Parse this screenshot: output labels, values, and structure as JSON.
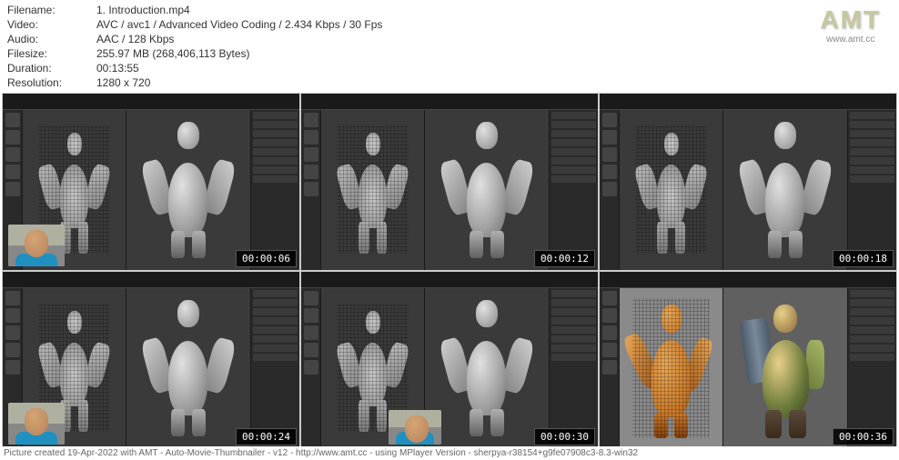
{
  "meta": {
    "filename_label": "Filename:",
    "filename": "1. Introduction.mp4",
    "video_label": "Video:",
    "video": "AVC / avc1 / Advanced Video Coding / 2.434 Kbps / 30 Fps",
    "audio_label": "Audio:",
    "audio": "AAC / 128 Kbps",
    "filesize_label": "Filesize:",
    "filesize": "255.97 MB (268,406,113 Bytes)",
    "duration_label": "Duration:",
    "duration": "00:13:55",
    "resolution_label": "Resolution:",
    "resolution": "1280 x 720"
  },
  "logo": {
    "text": "AMT",
    "url": "www.amt.cc"
  },
  "thumbs": {
    "t1": "00:00:06",
    "t2": "00:00:12",
    "t3": "00:00:18",
    "t4": "00:00:24",
    "t5": "00:00:30",
    "t6": "00:00:36"
  },
  "footer": "Picture created 19-Apr-2022 with AMT - Auto-Movie-Thumbnailer - v12 - http://www.amt.cc - using MPlayer Version - sherpya-r38154+g9fe07908c3-8.3-win32"
}
